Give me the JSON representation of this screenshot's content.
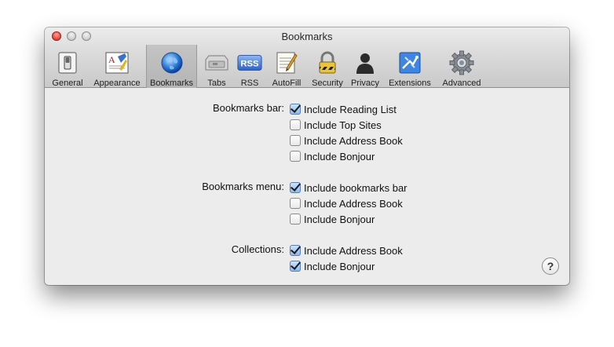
{
  "window": {
    "title": "Bookmarks"
  },
  "toolbar": {
    "items": [
      {
        "label": "General",
        "icon": "general-switch-icon"
      },
      {
        "label": "Appearance",
        "icon": "appearance-icon"
      },
      {
        "label": "Bookmarks",
        "icon": "globe-icon",
        "selected": true
      },
      {
        "label": "Tabs",
        "icon": "tabs-icon"
      },
      {
        "label": "RSS",
        "icon": "rss-icon",
        "badge": "RSS"
      },
      {
        "label": "AutoFill",
        "icon": "autofill-icon"
      },
      {
        "label": "Security",
        "icon": "lock-icon"
      },
      {
        "label": "Privacy",
        "icon": "privacy-person-icon"
      },
      {
        "label": "Extensions",
        "icon": "extensions-icon"
      },
      {
        "label": "Advanced",
        "icon": "gear-icon"
      }
    ]
  },
  "groups": {
    "bookmarks_bar": {
      "label": "Bookmarks bar:",
      "options": [
        {
          "label": "Include Reading List",
          "checked": true
        },
        {
          "label": "Include Top Sites",
          "checked": false
        },
        {
          "label": "Include Address Book",
          "checked": false
        },
        {
          "label": "Include Bonjour",
          "checked": false
        }
      ]
    },
    "bookmarks_menu": {
      "label": "Bookmarks menu:",
      "options": [
        {
          "label": "Include bookmarks bar",
          "checked": true
        },
        {
          "label": "Include Address Book",
          "checked": false
        },
        {
          "label": "Include Bonjour",
          "checked": false
        }
      ]
    },
    "collections": {
      "label": "Collections:",
      "options": [
        {
          "label": "Include Address Book",
          "checked": true
        },
        {
          "label": "Include Bonjour",
          "checked": true
        }
      ]
    }
  },
  "help": {
    "label": "?"
  },
  "colors": {
    "checked_fill": "#8fb8ee",
    "selected_tab": "#b4b4b4"
  }
}
